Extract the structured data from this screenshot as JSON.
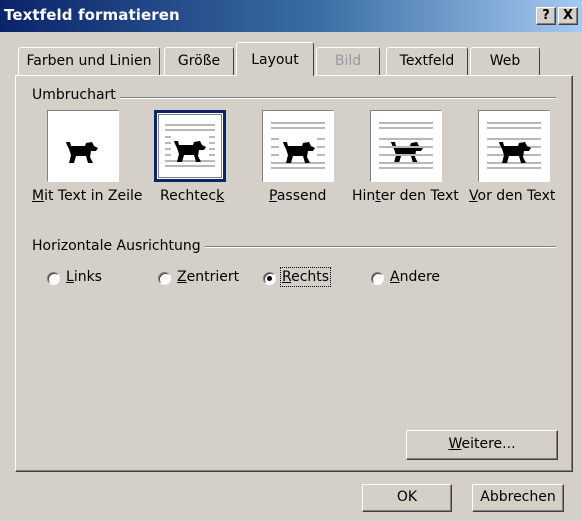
{
  "window": {
    "title": "Textfeld formatieren",
    "help_button": "?",
    "close_button": "X"
  },
  "tabs": [
    {
      "label": "Farben und Linien",
      "state": "normal"
    },
    {
      "label": "Größe",
      "state": "normal"
    },
    {
      "label": "Layout",
      "state": "active"
    },
    {
      "label": "Bild",
      "state": "disabled"
    },
    {
      "label": "Textfeld",
      "state": "normal"
    },
    {
      "label": "Web",
      "state": "normal"
    }
  ],
  "wrapping": {
    "group_label": "Umbruchart",
    "options": [
      {
        "label_pre": "",
        "label_key": "M",
        "label_post": "it Text in Zeile",
        "selected": false,
        "icon": "inline-dog-icon"
      },
      {
        "label_pre": "Rechtec",
        "label_key": "k",
        "label_post": "",
        "selected": true,
        "icon": "square-wrap-dog-icon"
      },
      {
        "label_pre": "",
        "label_key": "P",
        "label_post": "assend",
        "selected": false,
        "icon": "tight-wrap-dog-icon"
      },
      {
        "label_pre": "Hin",
        "label_key": "t",
        "label_post": "er den Text",
        "selected": false,
        "icon": "behind-text-dog-icon"
      },
      {
        "label_pre": "",
        "label_key": "V",
        "label_post": "or den Text",
        "selected": false,
        "icon": "in-front-dog-icon"
      }
    ]
  },
  "alignment": {
    "group_label": "Horizontale Ausrichtung",
    "options": [
      {
        "label_pre": "",
        "label_key": "L",
        "label_post": "inks",
        "checked": false
      },
      {
        "label_pre": "",
        "label_key": "Z",
        "label_post": "entriert",
        "checked": false
      },
      {
        "label_pre": "",
        "label_key": "R",
        "label_post": "echts",
        "checked": true
      },
      {
        "label_pre": "",
        "label_key": "A",
        "label_post": "ndere",
        "checked": false
      }
    ]
  },
  "buttons": {
    "more_pre": "",
    "more_key": "W",
    "more_post": "eitere...",
    "ok": "OK",
    "cancel": "Abbrechen"
  },
  "colors": {
    "title_gradient_start": "#0a246a",
    "title_gradient_end": "#a6caf0",
    "dialog_face": "#d4d0c8",
    "selection_border": "#0a246a"
  }
}
